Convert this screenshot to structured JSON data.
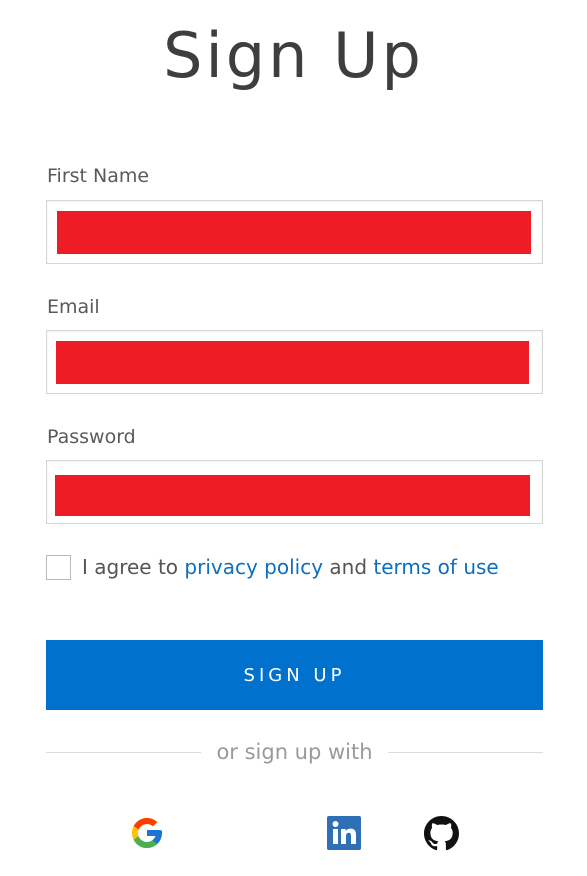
{
  "page": {
    "title": "Sign Up"
  },
  "form": {
    "first_name_label": "First Name",
    "email_label": "Email",
    "password_label": "Password",
    "redaction_color": "#ee1c25"
  },
  "agree": {
    "prefix": "I agree to",
    "privacy_link": "privacy policy",
    "and": "and",
    "terms_link": "terms of use",
    "checked": false
  },
  "signup_button": "SIGN UP",
  "divider_text": "or sign up with",
  "social": [
    {
      "icon": "google-icon"
    },
    {
      "icon": "linkedin-icon"
    },
    {
      "icon": "github-icon"
    }
  ],
  "colors": {
    "primary": "#0072ce",
    "link": "#0e6fbe",
    "linkedin": "#2f6fb5"
  }
}
